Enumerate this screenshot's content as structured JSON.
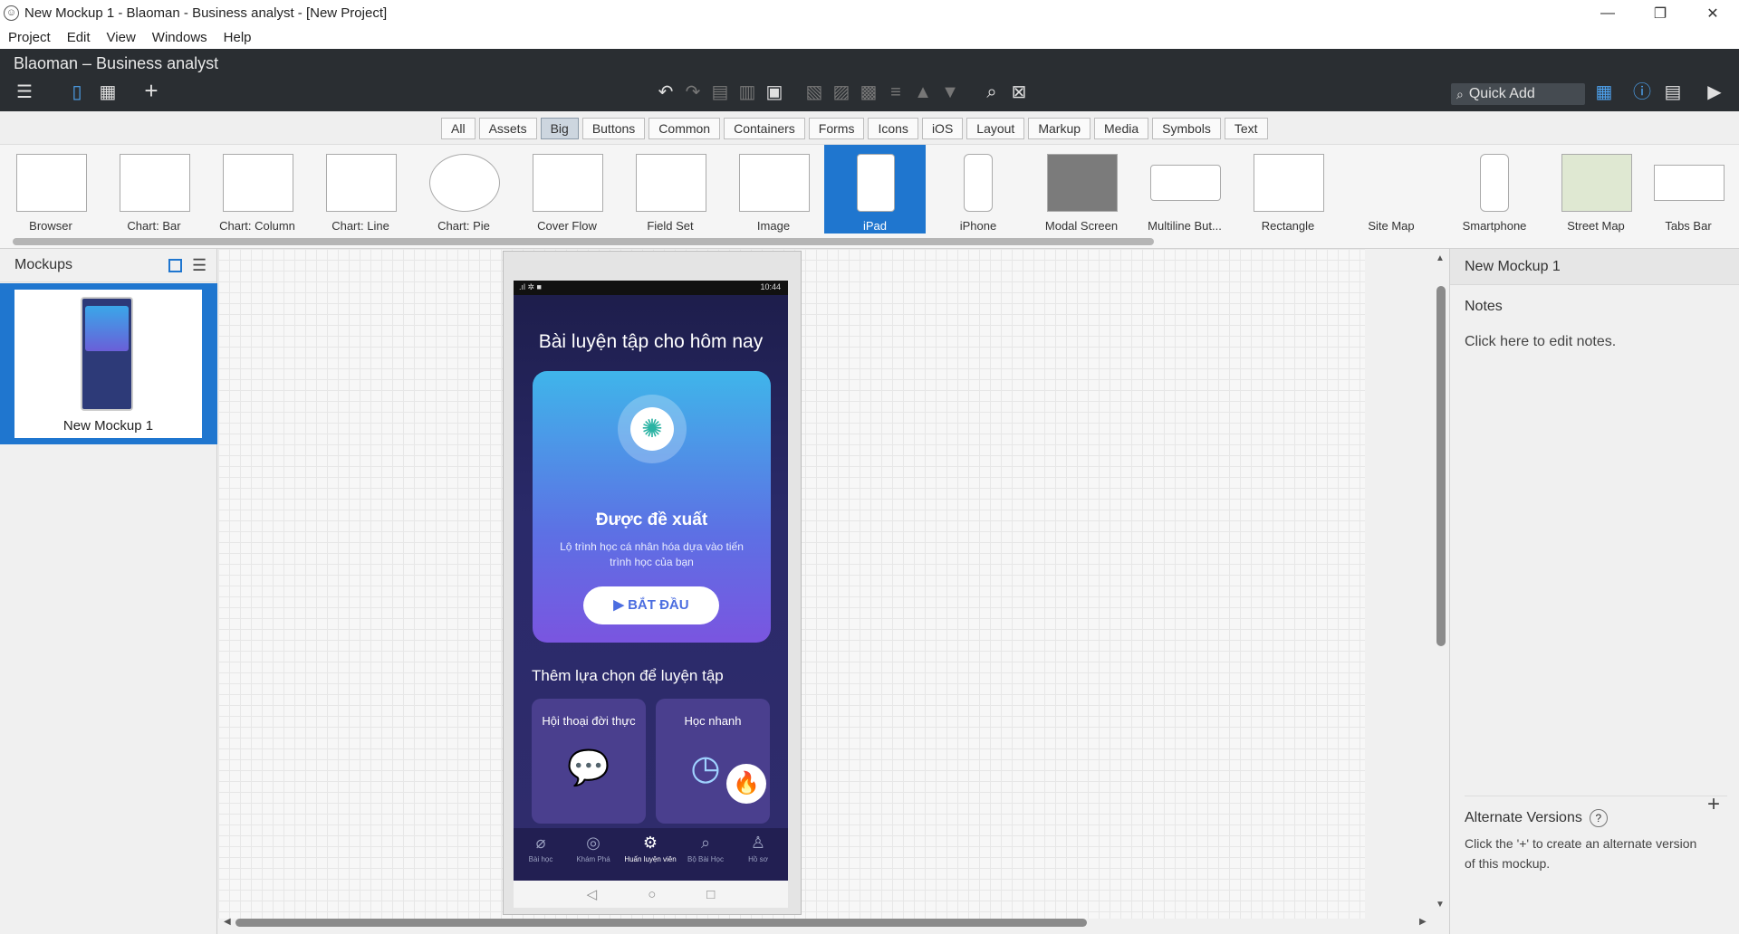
{
  "window": {
    "title": "New Mockup 1 - Blaoman - Business analyst  - [New Project]",
    "controls": [
      "—",
      "❐",
      "✕"
    ]
  },
  "menu": [
    "Project",
    "Edit",
    "View",
    "Windows",
    "Help"
  ],
  "header": {
    "project_title": "Blaoman – Business analyst",
    "quick_add_placeholder": "Quick Add"
  },
  "categories": {
    "tabs": [
      "All",
      "Assets",
      "Big",
      "Buttons",
      "Common",
      "Containers",
      "Forms",
      "Icons",
      "iOS",
      "Layout",
      "Markup",
      "Media",
      "Symbols",
      "Text"
    ],
    "active": "Big"
  },
  "components": [
    "Browser",
    "Chart: Bar",
    "Chart: Column",
    "Chart: Line",
    "Chart: Pie",
    "Cover Flow",
    "Field Set",
    "Image",
    "iPad",
    "iPhone",
    "Modal Screen",
    "Multiline But...",
    "Rectangle",
    "Site Map",
    "Smartphone",
    "Street Map",
    "Tabs Bar"
  ],
  "active_component": "iPad",
  "left_panel": {
    "title": "Mockups",
    "mockup_name": "New Mockup 1"
  },
  "phone": {
    "status_time": "10:44",
    "title": "Bài luyện tập cho hôm nay",
    "card_title": "Được đề xuất",
    "card_subtitle": "Lộ trình học cá nhân hóa dựa vào tiến trình học của bạn",
    "card_button": "▶ BẮT ĐẦU",
    "section_title": "Thêm lựa chọn để luyện tập",
    "option_1": "Hội thoại đời thực",
    "option_2": "Học nhanh",
    "tabs": [
      {
        "label": "Bài học",
        "icon": "⌀"
      },
      {
        "label": "Khám Phá",
        "icon": "◎"
      },
      {
        "label": "Huấn luyện viên",
        "icon": "⚙"
      },
      {
        "label": "Bộ Bài Học",
        "icon": "⌕"
      },
      {
        "label": "Hồ sơ",
        "icon": "♙"
      }
    ],
    "active_tab": "Huấn luyện viên",
    "nav_keys": [
      "◁",
      "○",
      "□"
    ]
  },
  "right_panel": {
    "title": "New Mockup 1",
    "notes_label": "Notes",
    "notes_hint": "Click here to edit notes.",
    "alt_label": "Alternate Versions",
    "alt_help": "?",
    "alt_add": "+",
    "alt_hint": "Click the '+' to create an alternate version of this mockup."
  },
  "colors": {
    "accent": "#1f76cf",
    "dark_toolbar": "#2a2e32"
  }
}
